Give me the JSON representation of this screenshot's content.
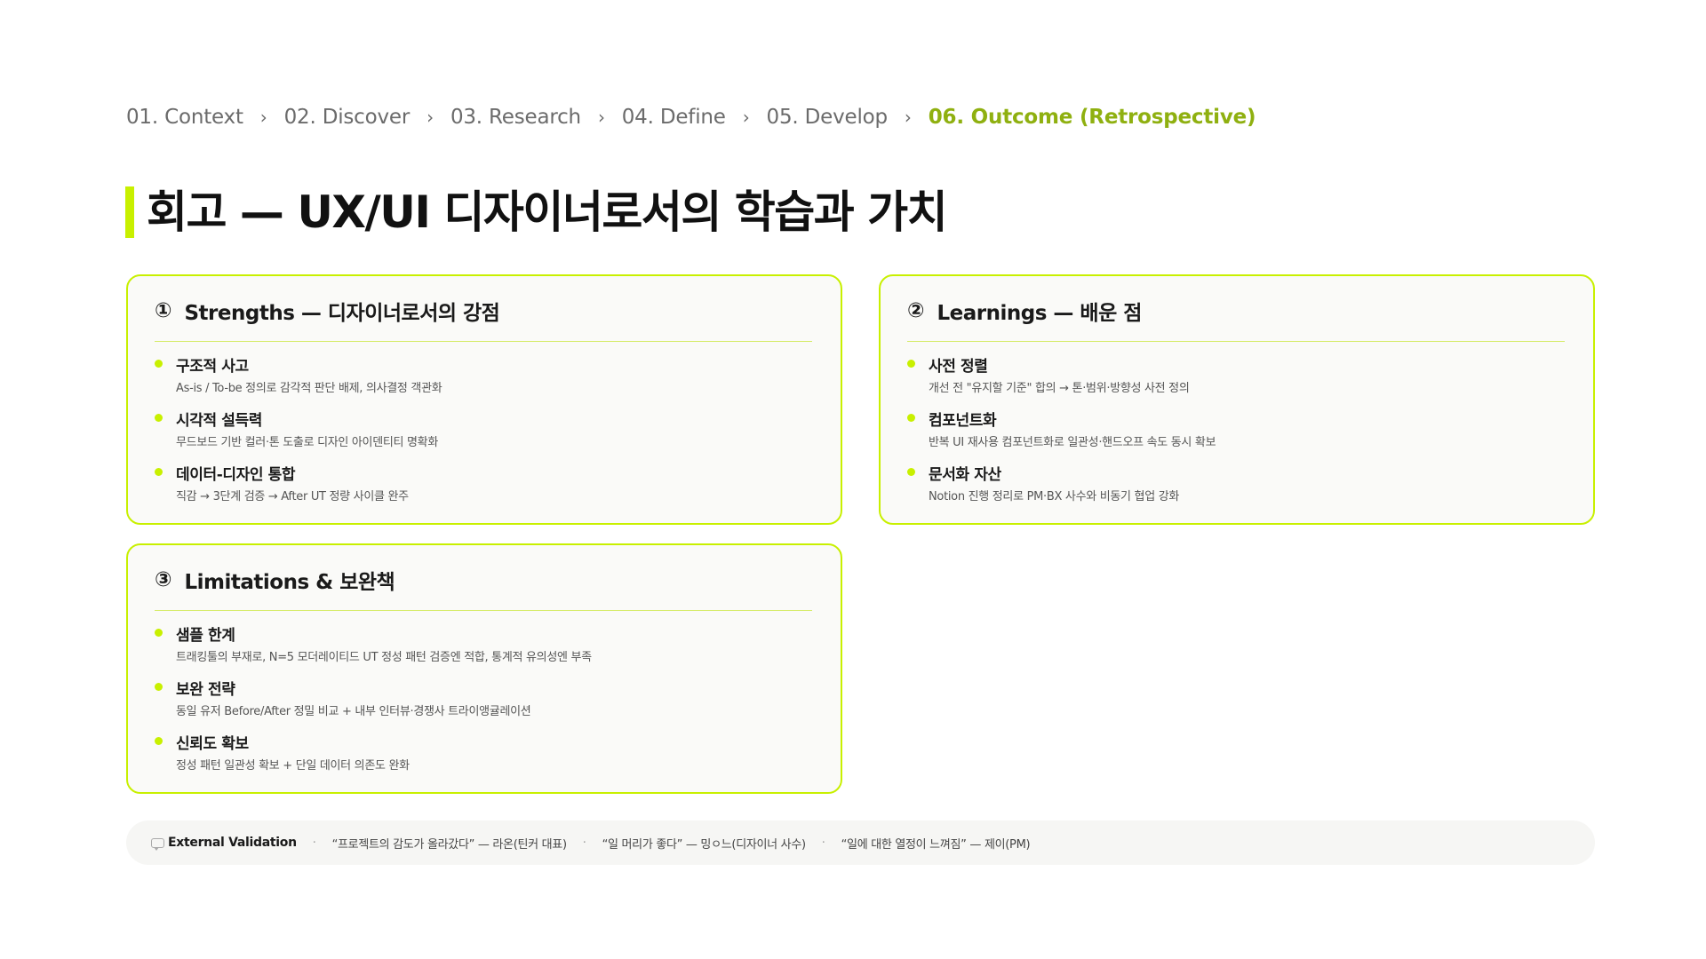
{
  "breadcrumb": [
    {
      "label": "01. Context"
    },
    {
      "label": "02. Discover"
    },
    {
      "label": "03. Research"
    },
    {
      "label": "04. Define"
    },
    {
      "label": "05. Develop"
    },
    {
      "label": "06. Outcome (Retrospective)"
    }
  ],
  "breadcrumb_separator": "›",
  "page_title": "회고 — UX/UI 디자이너로서의 학습과 가치",
  "cards": [
    {
      "num": "①",
      "title": "Strengths — 디자이너로서의 강점",
      "items": [
        {
          "title": "구조적 사고",
          "desc": "As-is / To-be 정의로 감각적 판단 배제, 의사결정 객관화"
        },
        {
          "title": "시각적 설득력",
          "desc": "무드보드 기반 컬러·톤 도출로 디자인 아이덴티티 명확화"
        },
        {
          "title": "데이터-디자인 통합",
          "desc": "직감 → 3단계 검증 → After UT 정량 사이클 완주"
        }
      ]
    },
    {
      "num": "②",
      "title": "Learnings — 배운 점",
      "items": [
        {
          "title": "사전 정렬",
          "desc": "개선 전 \"유지할 기준\" 합의 → 톤·범위·방향성 사전 정의"
        },
        {
          "title": "컴포넌트화",
          "desc": "반복 UI 재사용 컴포넌트화로 일관성·핸드오프 속도 동시 확보"
        },
        {
          "title": "문서화 자산",
          "desc": "Notion 진행 정리로 PM·BX 사수와 비동기 협업 강화"
        }
      ]
    },
    {
      "num": "③",
      "title": "Limitations & 보완책",
      "items": [
        {
          "title": "샘플 한계",
          "desc": "트래킹툴의 부재로, N=5 모더레이티드 UT 정성 패턴 검증엔 적합, 통계적 유의성엔 부족"
        },
        {
          "title": "보완 전략",
          "desc": "동일 유저 Before/After 정밀 비교 + 내부 인터뷰·경쟁사 트라이앵귤레이션"
        },
        {
          "title": "신뢰도 확보",
          "desc": "정성 패턴 일관성 확보 + 단일 데이터 의존도 완화"
        }
      ]
    }
  ],
  "validation": {
    "icon": "speech-bubble-icon",
    "label": "External Validation",
    "separator": "·",
    "quotes": [
      "“프로젝트의 감도가 올라갔다” — 라온(틴커 대표)",
      "“일 머리가 좋다” — 밍ㅇ느(디자이너 사수)",
      "“일에 대한 열정이 느껴짐” — 제이(PM)"
    ]
  },
  "colors": {
    "accent": "#c8f000",
    "active_crumb": "#8fb010",
    "text": "#1a1a1a",
    "muted": "#6b6b6b"
  }
}
